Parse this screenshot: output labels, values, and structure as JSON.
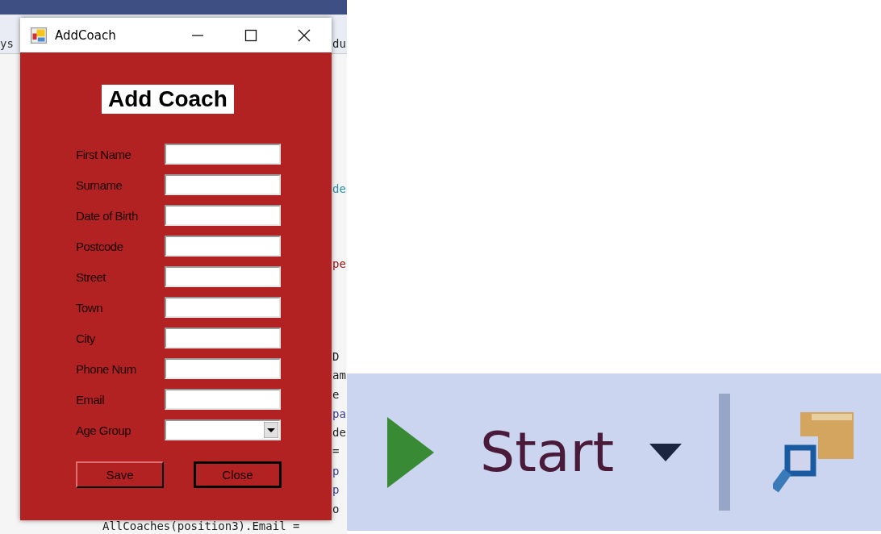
{
  "editor": {
    "left_fragment": "ys",
    "right_fragments": [
      "du",
      "de",
      "pe",
      "D",
      "am",
      "e",
      "pa",
      "de",
      "=",
      "p",
      "p",
      "o"
    ],
    "bottom_line": "AllCoaches(position3).Email ="
  },
  "dialog": {
    "title": "AddCoach",
    "heading": "Add Coach",
    "fields": [
      {
        "label": "First Name",
        "kind": "text"
      },
      {
        "label": "Surname",
        "kind": "text"
      },
      {
        "label": "Date of Birth",
        "kind": "text"
      },
      {
        "label": "Postcode",
        "kind": "text"
      },
      {
        "label": "Street",
        "kind": "text"
      },
      {
        "label": "Town",
        "kind": "text"
      },
      {
        "label": "City",
        "kind": "text"
      },
      {
        "label": "Phone Num",
        "kind": "text"
      },
      {
        "label": "Email",
        "kind": "text"
      },
      {
        "label": "Age Group",
        "kind": "dropdown"
      }
    ],
    "buttons": [
      {
        "label": "Save",
        "focused": false
      },
      {
        "label": "Close",
        "focused": true
      }
    ]
  },
  "toolbar": {
    "start_label": "Start"
  }
}
